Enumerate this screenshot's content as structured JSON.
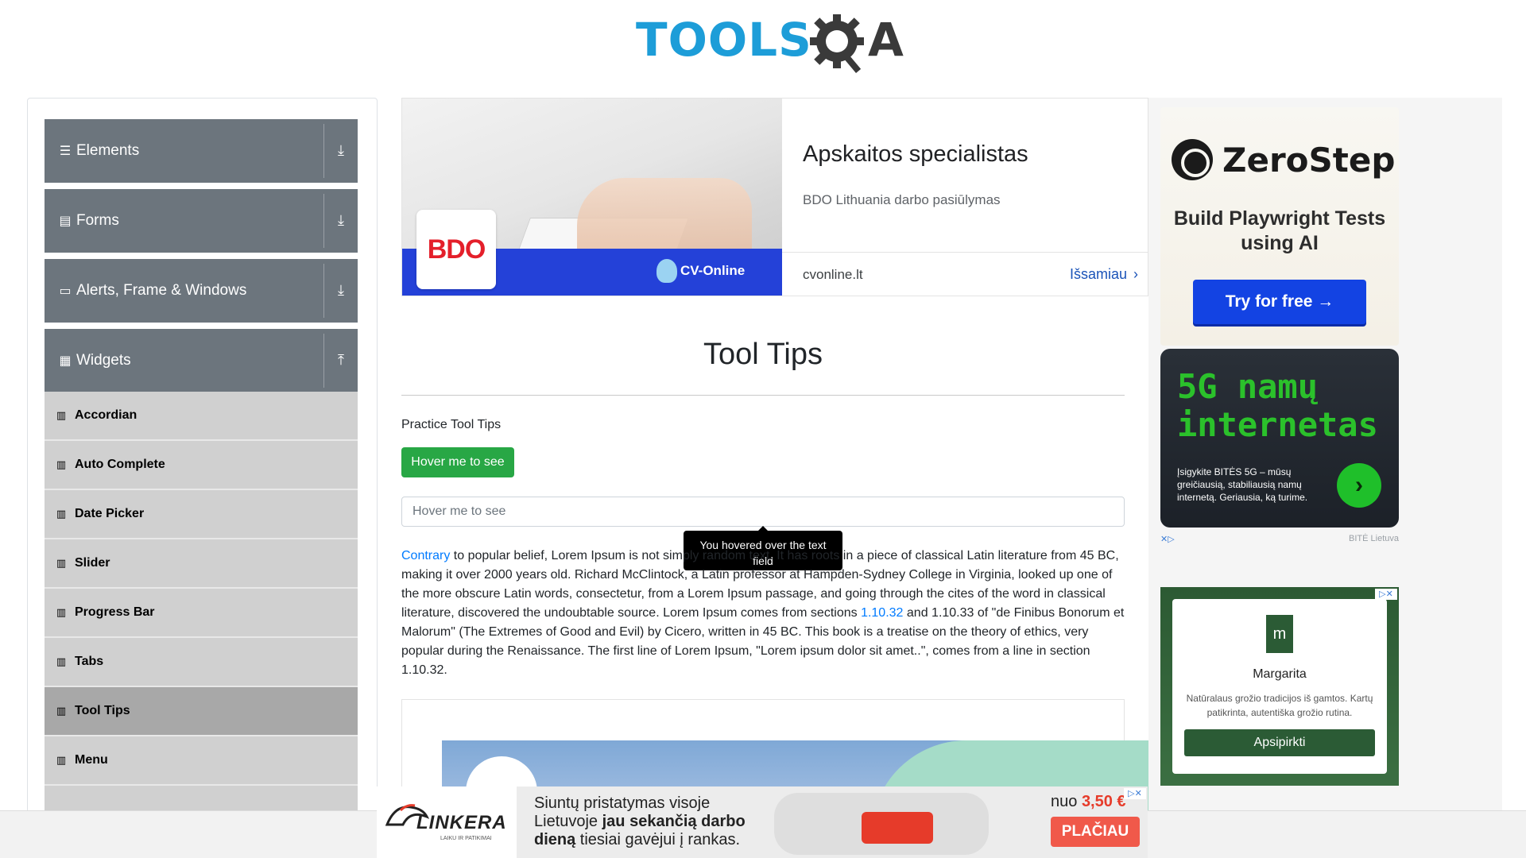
{
  "header": {
    "logo_left": "TOOLS",
    "logo_right": "QA"
  },
  "sidebar": {
    "groups": [
      {
        "label": "Elements",
        "icon": "menu-icon",
        "state": "collapsed"
      },
      {
        "label": "Forms",
        "icon": "document-icon",
        "state": "collapsed"
      },
      {
        "label": "Alerts, Frame & Windows",
        "icon": "window-icon",
        "state": "collapsed"
      },
      {
        "label": "Widgets",
        "icon": "widgets-icon",
        "state": "expanded"
      }
    ],
    "items": [
      {
        "label": "Accordian"
      },
      {
        "label": "Auto Complete"
      },
      {
        "label": "Date Picker"
      },
      {
        "label": "Slider"
      },
      {
        "label": "Progress Bar"
      },
      {
        "label": "Tabs"
      },
      {
        "label": "Tool Tips",
        "active": true
      },
      {
        "label": "Menu"
      }
    ]
  },
  "top_ad": {
    "title": "Apskaitos specialistas",
    "subtitle": "BDO Lithuania darbo pasiūlymas",
    "domain": "cvonline.lt",
    "cta": "Išsamiau",
    "brand": "BDO",
    "partner": "CV-Online"
  },
  "main": {
    "title": "Tool Tips",
    "practice_label": "Practice Tool Tips",
    "button_label": "Hover me to see",
    "input_placeholder": "Hover me to see",
    "tooltip_text": "You hovered over the text field",
    "paragraph": {
      "link1": "Contrary",
      "part1": " to popular belief, Lorem Ipsum is not simply random text. It has roots in a piece of classical Latin literature from 45 BC, making it over 2000 years old. Richard McClintock, a Latin professor at Hampden-Sydney College in Virginia, looked up one of the more obscure Latin words, consectetur, from a Lorem Ipsum passage, and going through the cites of the word in classical literature, discovered the undoubtable source. Lorem Ipsum comes from sections ",
      "link2": "1.10.32",
      "part2": " and 1.10.33 of \"de Finibus Bonorum et Malorum\" (The Extremes of Good and Evil) by Cicero, written in 45 BC. This book is a treatise on the theory of ethics, very popular during the Renaissance. The first line of Lorem Ipsum, \"Lorem ipsum dolor sit amet..\", comes from a line in section 1.10.32."
    }
  },
  "right_ads": {
    "zerostep": {
      "brand": "ZeroStep",
      "headline": "Build Playwright Tests using AI",
      "cta": "Try for free →"
    },
    "fiveg": {
      "title": "5G namų internetas",
      "text": "Įsigykite BITĖS 5G – mūsų greičiausią, stabiliausią namų internetą. Geriausia, ką turime.",
      "brand": "BITĖ Lietuva"
    },
    "margarita": {
      "logo": "m",
      "name": "Margarita",
      "desc": "Natūralaus grožio tradicijos iš gamtos. Kartų patikrinta, autentiška grožio rutina.",
      "cta": "Apsipirkti"
    }
  },
  "bottom_ad": {
    "brand": "LINKERA",
    "tagline": "LAIKU IR PATIKIMAI",
    "line1": "Siuntų pristatymas visoje",
    "line2_pre": "Lietuvoje ",
    "line2_bold": "jau sekančią darbo",
    "line3_bold": "dieną",
    "line3_post": " tiesiai gavėjui į rankas.",
    "price_pre": "nuo ",
    "price": "3,50 €",
    "cta": "PLAČIAU"
  },
  "colors": {
    "sidebar_header": "#6c757d",
    "sidebar_item": "#d0d0d0",
    "sidebar_item_active": "#a8a8a8",
    "button_green": "#28a745",
    "link_blue": "#007bff",
    "logo_blue": "#1d9dd8"
  }
}
